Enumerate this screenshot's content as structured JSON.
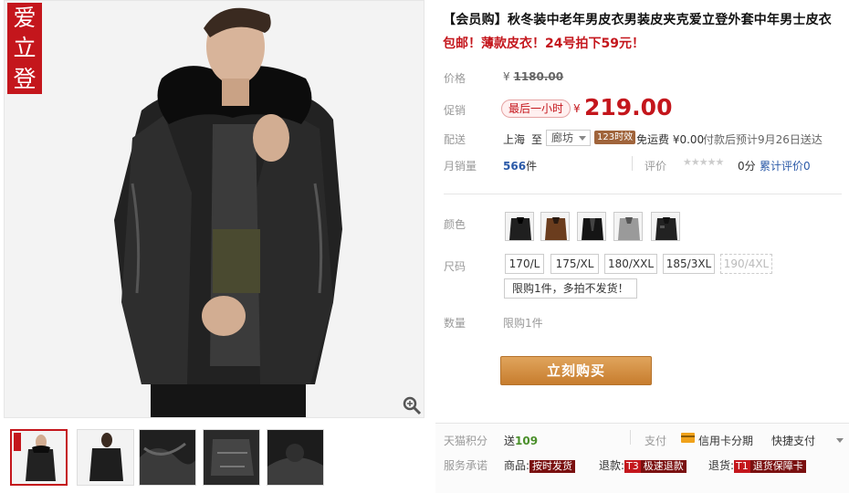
{
  "brand_logo": [
    "爱",
    "立",
    "登"
  ],
  "title": "【会员购】秋冬装中老年男皮衣男装皮夹克爱立登外套中年男士皮衣",
  "promo": "包邮！薄款皮衣！24号拍下59元！",
  "price": {
    "label": "价格",
    "currency": "¥",
    "original": "1180.00"
  },
  "promo_price": {
    "label": "促销",
    "tag": "最后一小时",
    "currency": "¥",
    "value": "219.00"
  },
  "delivery": {
    "label": "配送",
    "from": "上海",
    "to_word": "至",
    "to_city": "廊坊",
    "time_badge": "123时效",
    "shipping": "免运费 ¥0.00",
    "eta": "付款后预计9月26日送达"
  },
  "sales": {
    "label": "月销量",
    "count": "566",
    "unit": "件",
    "rating_label": "评价",
    "stars": "★★★★★",
    "score": "0分",
    "review_label": "累计评价",
    "review_count": "0"
  },
  "color": {
    "label": "颜色",
    "swatches": [
      "black-jacket",
      "brown-jacket",
      "black-jacket-2",
      "grey-jacket",
      "black-jacket-3"
    ]
  },
  "size": {
    "label": "尺码",
    "options": [
      "170/L",
      "175/XL",
      "180/XXL",
      "185/3XL",
      "190/4XL"
    ],
    "limit_note": "限购1件，多拍不发货！"
  },
  "quantity": {
    "label": "数量",
    "note": "限购1件"
  },
  "buy_button": "立刻购买",
  "bottom": {
    "points_label": "天猫积分",
    "points_prefix": "送",
    "points_value": "109",
    "pay_label": "支付",
    "credit_card": "信用卡分期",
    "quick_pay": "快捷支付",
    "service_label": "服务承诺",
    "goods_label": "商品:",
    "goods_tag": "按时发货",
    "refund_label": "退款:",
    "refund_code": "T3",
    "refund_tag": "极速退款",
    "return_label": "退货:",
    "return_code": "T1",
    "return_tag": "退货保障卡"
  },
  "colors": {
    "accent_red": "#c4161c",
    "buy_button": "#c77d2e"
  }
}
